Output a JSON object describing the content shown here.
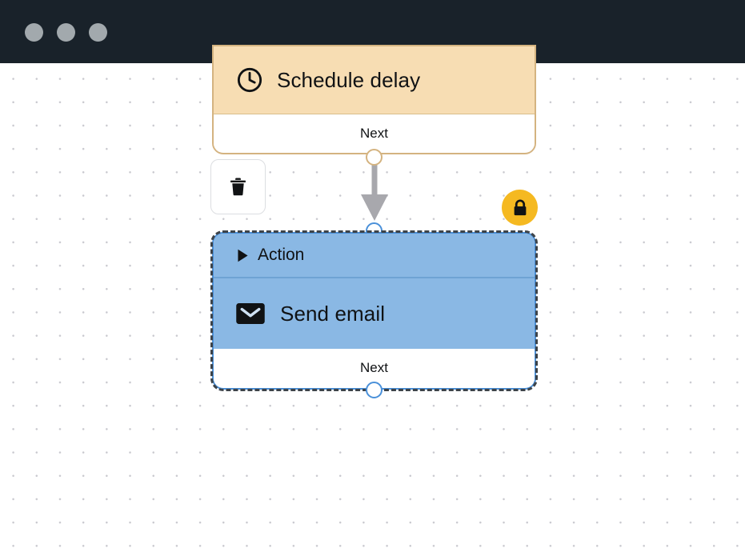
{
  "window": {
    "titlebar": {
      "controls": [
        {
          "name": "close-button",
          "label": ""
        },
        {
          "name": "minimize-button",
          "label": ""
        },
        {
          "name": "maximize-button",
          "label": ""
        }
      ],
      "background_color": "#19222a",
      "control_color": "#a2a9ad"
    }
  },
  "canvas": {
    "background_color": "#ffffff",
    "dot_color": "#c9c9cf",
    "grid_spacing": 29
  },
  "nodes": {
    "schedule_delay": {
      "title": "Schedule delay",
      "icon": "clock-icon",
      "footer_label": "Next",
      "header_color": "#f7ddb3",
      "border_color": "#d4b380",
      "port_color": "#d4b380"
    },
    "action": {
      "header_label": "Action",
      "header_icon": "triangle-right-icon",
      "row_label": "Send email",
      "row_icon": "envelope-icon",
      "footer_label": "Next",
      "body_color": "#8ab8e4",
      "border_color": "#4a90d9",
      "selection_border_color": "#3d4349",
      "selected": true
    }
  },
  "connector": {
    "from": "schedule_delay.next",
    "to": "action.input",
    "arrow_color": "#a8a8ad"
  },
  "controls": {
    "delete_button": {
      "icon": "trash-icon",
      "label": ""
    },
    "lock_badge": {
      "icon": "lock-icon",
      "label": "",
      "color": "#f5b921"
    }
  }
}
